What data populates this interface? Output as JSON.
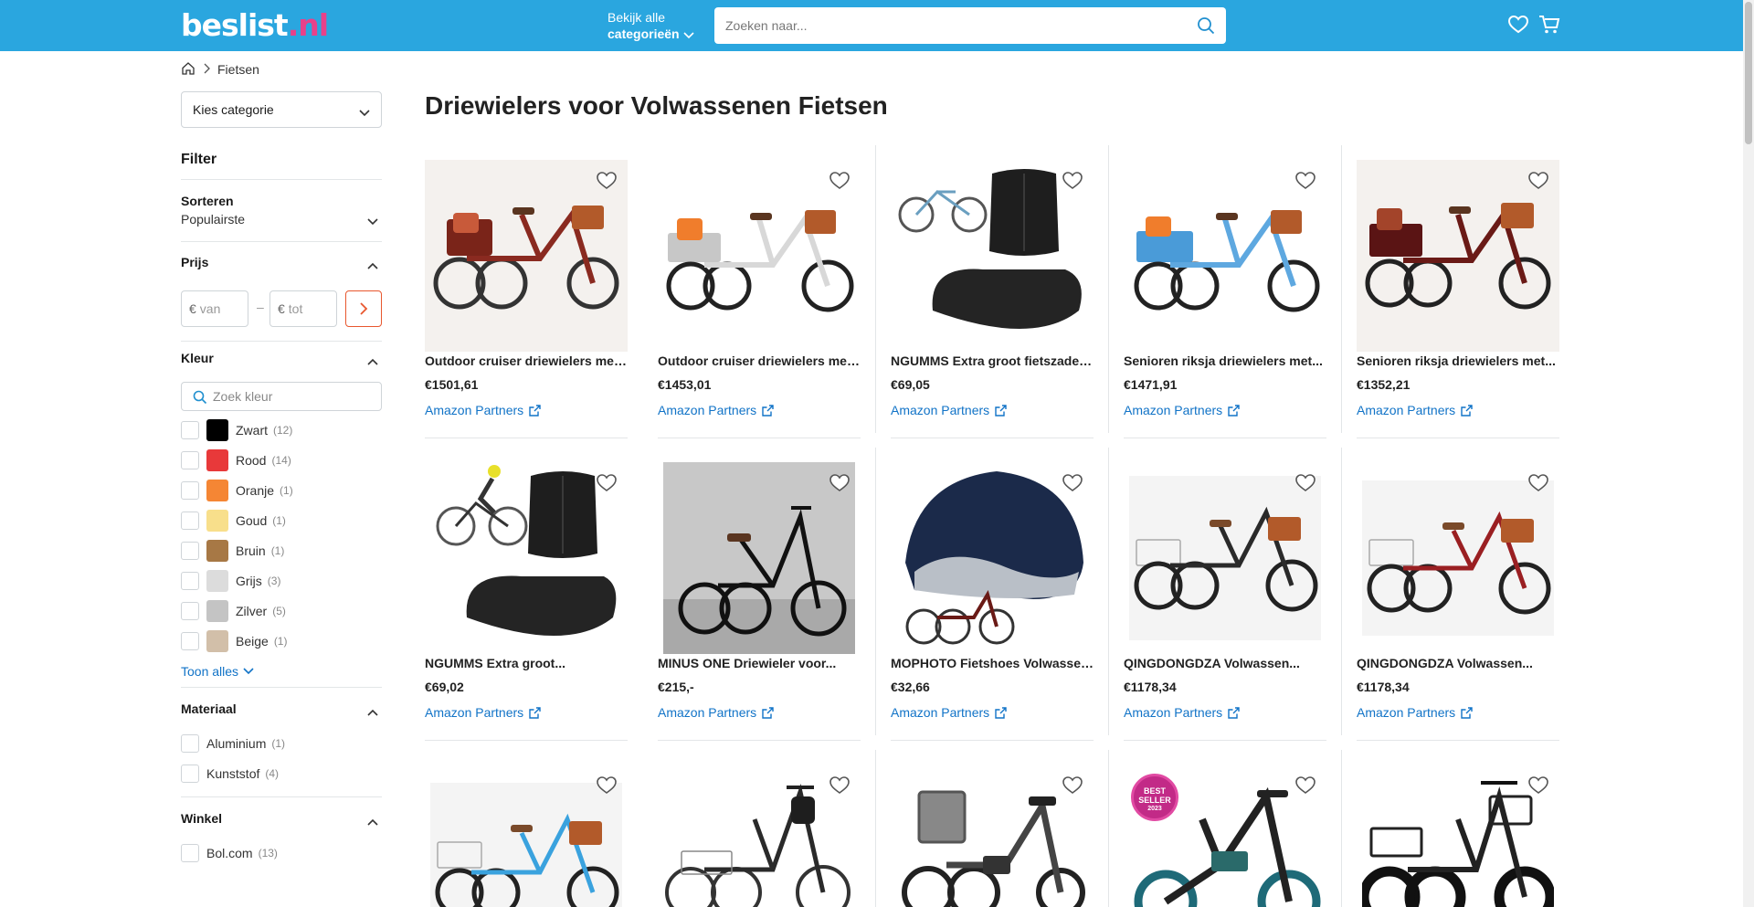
{
  "header": {
    "logo_main": "beslist",
    "logo_tld": ".nl",
    "categories_line1": "Bekijk alle",
    "categories_line2": "categorieën",
    "search_placeholder": "Zoeken naar..."
  },
  "breadcrumb": {
    "current": "Fietsen"
  },
  "sidebar": {
    "category_select": "Kies categorie",
    "filter_title": "Filter",
    "sort": {
      "title": "Sorteren",
      "value": "Populairste"
    },
    "price": {
      "title": "Prijs",
      "currency": "€",
      "from_placeholder": "van",
      "to_placeholder": "tot",
      "dash": "–"
    },
    "color": {
      "title": "Kleur",
      "search_placeholder": "Zoek kleur",
      "options": [
        {
          "label": "Zwart",
          "count": "(12)",
          "color": "#000000"
        },
        {
          "label": "Rood",
          "count": "(14)",
          "color": "#e8393a"
        },
        {
          "label": "Oranje",
          "count": "(1)",
          "color": "#f58634"
        },
        {
          "label": "Goud",
          "count": "(1)",
          "color": "#f8df8b"
        },
        {
          "label": "Bruin",
          "count": "(1)",
          "color": "#a77845"
        },
        {
          "label": "Grijs",
          "count": "(3)",
          "color": "#dcdcdc"
        },
        {
          "label": "Zilver",
          "count": "(5)",
          "color": "#c4c4c4"
        },
        {
          "label": "Beige",
          "count": "(1)",
          "color": "#d2bfa9"
        }
      ],
      "show_all": "Toon alles"
    },
    "material": {
      "title": "Materiaal",
      "options": [
        {
          "label": "Aluminium",
          "count": "(1)"
        },
        {
          "label": "Kunststof",
          "count": "(4)"
        }
      ]
    },
    "shop": {
      "title": "Winkel",
      "options": [
        {
          "label": "Bol.com",
          "count": "(13)"
        }
      ]
    }
  },
  "main": {
    "title": "Driewielers voor Volwassenen Fietsen",
    "products": [
      {
        "title": "Outdoor cruiser driewielers met...",
        "price": "€1501,61",
        "shop": "Amazon Partners",
        "image": "tricycle-red"
      },
      {
        "title": "Outdoor cruiser driewielers met...",
        "price": "€1453,01",
        "shop": "Amazon Partners",
        "image": "tricycle-white"
      },
      {
        "title": "NGUMMS Extra groot fietszadel l...",
        "price": "€69,05",
        "shop": "Amazon Partners",
        "image": "seat"
      },
      {
        "title": "Senioren riksja driewielers met...",
        "price": "€1471,91",
        "shop": "Amazon Partners",
        "image": "tricycle-blue"
      },
      {
        "title": "Senioren riksja driewielers met...",
        "price": "€1352,21",
        "shop": "Amazon Partners",
        "image": "tricycle-darkred"
      },
      {
        "title": "NGUMMS Extra groot...",
        "price": "€69,02",
        "shop": "Amazon Partners",
        "image": "seat"
      },
      {
        "title": "MINUS ONE Driewieler voor...",
        "price": "€215,-",
        "shop": "Amazon Partners",
        "image": "tricycle-black"
      },
      {
        "title": "MOPHOTO Fietshoes Volwassen...",
        "price": "€32,66",
        "shop": "Amazon Partners",
        "image": "bike-cover"
      },
      {
        "title": "QINGDONGDZA Volwassen...",
        "price": "€1178,34",
        "shop": "Amazon Partners",
        "image": "tricycle-black"
      },
      {
        "title": "QINGDONGDZA Volwassen...",
        "price": "€1178,34",
        "shop": "Amazon Partners",
        "image": "tricycle-red"
      },
      {
        "image": "tricycle-lightblue"
      },
      {
        "image": "tricycle-grey"
      },
      {
        "image": "ebike-trike"
      },
      {
        "image": "ebike-fold",
        "badge_line1": "BEST",
        "badge_line2": "SELLER",
        "badge_line3": "2023"
      },
      {
        "image": "fat-trike"
      }
    ]
  }
}
